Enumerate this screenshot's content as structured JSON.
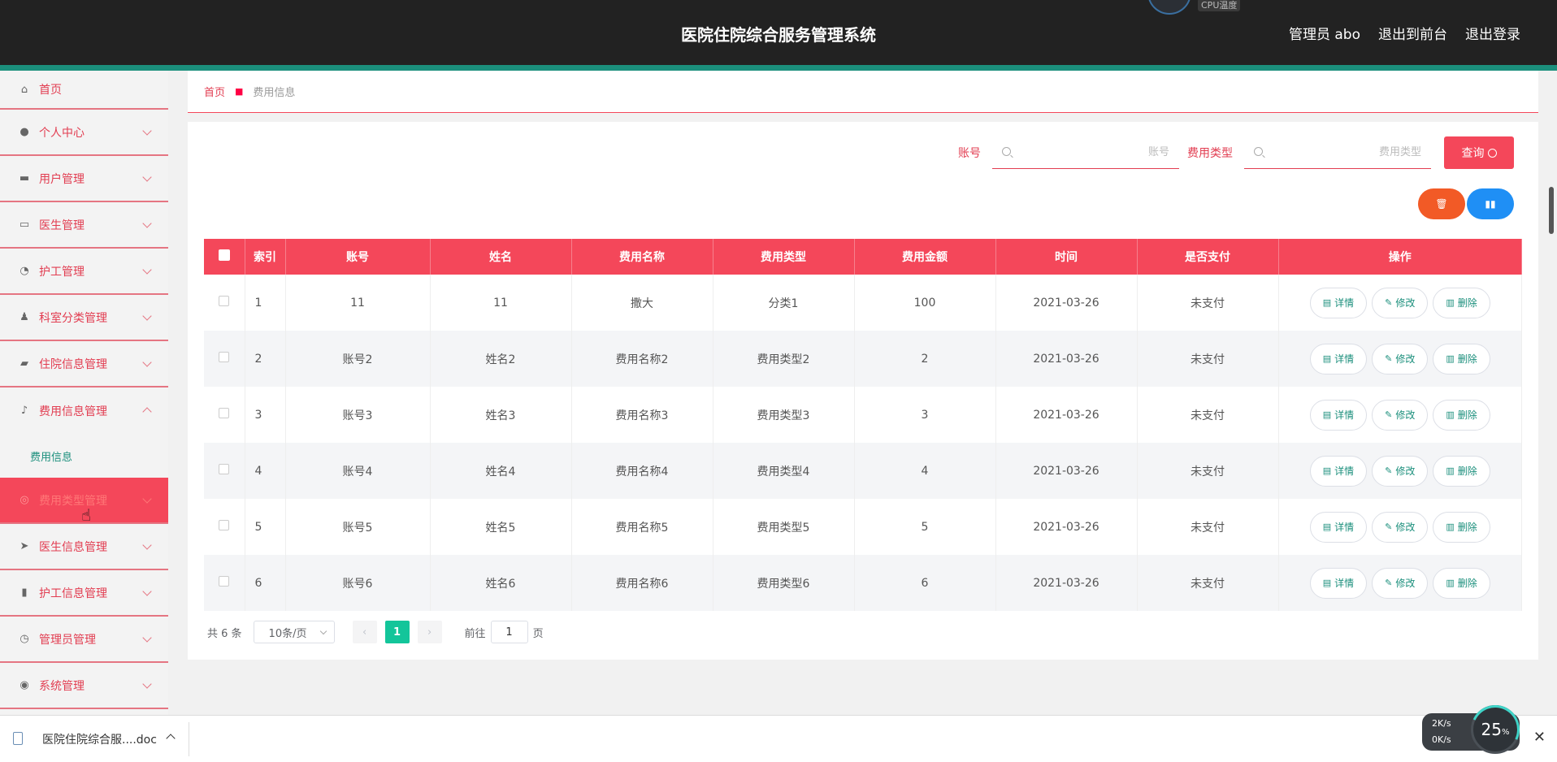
{
  "header": {
    "title": "医院住院综合服务管理系统",
    "user": "管理员 abo",
    "to_front": "退出到前台",
    "logout": "退出登录",
    "cpu_label": "CPU温度"
  },
  "sidebar": {
    "items": [
      {
        "label": "首页",
        "icon": "home-icon"
      },
      {
        "label": "个人中心",
        "icon": "user-icon"
      },
      {
        "label": "用户管理",
        "icon": "ticket-icon"
      },
      {
        "label": "医生管理",
        "icon": "monitor-icon"
      },
      {
        "label": "护工管理",
        "icon": "gauge-icon"
      },
      {
        "label": "科室分类管理",
        "icon": "person-icon"
      },
      {
        "label": "住院信息管理",
        "icon": "chat-icon"
      },
      {
        "label": "费用信息管理",
        "icon": "mic-icon"
      },
      {
        "label": "费用类型管理",
        "icon": "basketball-icon"
      },
      {
        "label": "医生信息管理",
        "icon": "send-icon"
      },
      {
        "label": "护工信息管理",
        "icon": "bar-chart-icon"
      },
      {
        "label": "管理员管理",
        "icon": "clock-icon"
      },
      {
        "label": "系统管理",
        "icon": "lifebuoy-icon"
      }
    ],
    "submenu_fee": "费用信息"
  },
  "breadcrumb": {
    "home": "首页",
    "current": "费用信息"
  },
  "search": {
    "account_label": "账号",
    "account_placeholder": "账号",
    "type_label": "费用类型",
    "type_placeholder": "费用类型",
    "query_button": "查询"
  },
  "table": {
    "headers": [
      "索引",
      "账号",
      "姓名",
      "费用名称",
      "费用类型",
      "费用金额",
      "时间",
      "是否支付",
      "操作"
    ],
    "rows": [
      [
        "1",
        "11",
        "11",
        "撒大",
        "分类1",
        "100",
        "2021-03-26",
        "未支付"
      ],
      [
        "2",
        "账号2",
        "姓名2",
        "费用名称2",
        "费用类型2",
        "2",
        "2021-03-26",
        "未支付"
      ],
      [
        "3",
        "账号3",
        "姓名3",
        "费用名称3",
        "费用类型3",
        "3",
        "2021-03-26",
        "未支付"
      ],
      [
        "4",
        "账号4",
        "姓名4",
        "费用名称4",
        "费用类型4",
        "4",
        "2021-03-26",
        "未支付"
      ],
      [
        "5",
        "账号5",
        "姓名5",
        "费用名称5",
        "费用类型5",
        "5",
        "2021-03-26",
        "未支付"
      ],
      [
        "6",
        "账号6",
        "姓名6",
        "费用名称6",
        "费用类型6",
        "6",
        "2021-03-26",
        "未支付"
      ]
    ],
    "ops": {
      "detail": "详情",
      "edit": "修改",
      "delete": "删除"
    }
  },
  "pager": {
    "total": "共 6 条",
    "page_size": "10条/页",
    "current": "1",
    "goto_prefix": "前往",
    "goto_value": "1",
    "goto_suffix": "页"
  },
  "download": {
    "filename": "医院住院综合服....doc"
  },
  "net": {
    "up": "2K/s",
    "down": "0K/s",
    "percent": "25",
    "percent_unit": "%"
  },
  "colors": {
    "accent": "#f4475a",
    "header": "#222222",
    "teal": "#1b8f7c"
  }
}
